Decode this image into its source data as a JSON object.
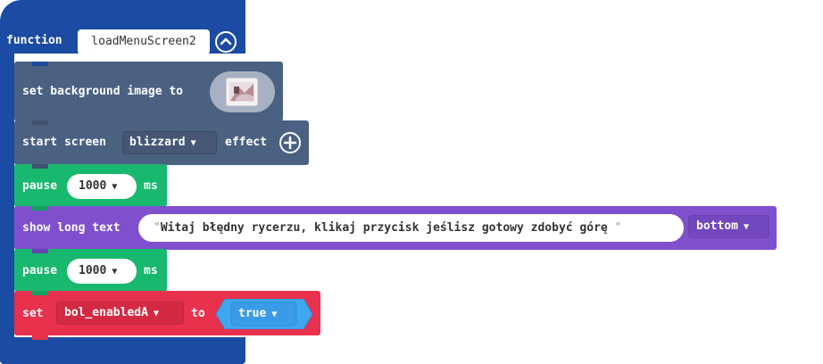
{
  "function": {
    "keyword": "function",
    "name": "loadMenuScreen2"
  },
  "blocks": {
    "set_bg": {
      "label": "set background image to"
    },
    "start_screen": {
      "label": "start screen",
      "effect_value": "blizzard",
      "label2": "effect"
    },
    "pause1": {
      "label": "pause",
      "value": "1000",
      "unit": "ms"
    },
    "show_text": {
      "label": "show long text",
      "text": "Witaj błędny rycerzu, klikaj przycisk jeślisz gotowy zdobyć górę",
      "position": "bottom"
    },
    "pause2": {
      "label": "pause",
      "value": "1000",
      "unit": "ms"
    },
    "set_var": {
      "label": "set",
      "variable": "bol_enabledA",
      "label2": "to",
      "value": "true"
    }
  },
  "colors": {
    "function": "#1b4ba3",
    "scene": "#4b6182",
    "loops": "#18b86e",
    "game": "#7f50ce",
    "variables": "#e8314d",
    "logic": "#3fa6f2"
  },
  "icons": [
    "collapse-arrow-icon",
    "dropdown-caret-icon",
    "add-plus-icon",
    "image-thumbnail"
  ]
}
